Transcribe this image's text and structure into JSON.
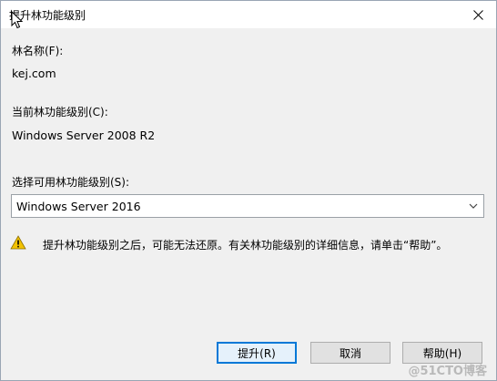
{
  "window": {
    "title": "提升林功能级别"
  },
  "forest_name": {
    "label": "林名称(F):",
    "value": "kej.com"
  },
  "current_level": {
    "label": "当前林功能级别(C):",
    "value": "Windows Server 2008 R2"
  },
  "select_level": {
    "label": "选择可用林功能级别(S):",
    "selected": "Windows Server 2016"
  },
  "warning": {
    "text": "提升林功能级别之后，可能无法还原。有关林功能级别的详细信息，请单击“帮助”。"
  },
  "buttons": {
    "raise": "提升(R)",
    "cancel": "取消",
    "help": "帮助(H)"
  },
  "watermark": "@51CTO博客",
  "colors": {
    "accent": "#0078d7",
    "warning": "#f2c200"
  }
}
